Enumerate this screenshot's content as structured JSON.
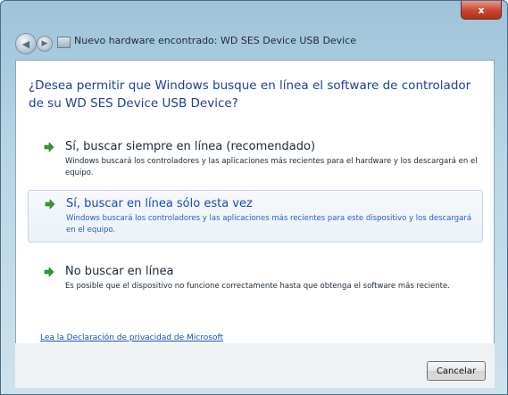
{
  "window": {
    "title": "Nuevo hardware encontrado: WD SES Device USB Device",
    "close_label": "x"
  },
  "question": "¿Desea permitir que Windows busque en línea el software de controlador de su WD SES Device USB Device?",
  "options": [
    {
      "title": "Sí, buscar siempre en línea (recomendado)",
      "description": "Windows buscará los controladores y las aplicaciones más recientes para el hardware y los descargará en el equipo."
    },
    {
      "title": "Sí, buscar en línea sólo esta vez",
      "description": "Windows buscará los controladores y las aplicaciones más recientes para este dispositivo y los descargará en el equipo."
    },
    {
      "title": "No buscar en línea",
      "description": "Es posible que el dispositivo no funcione correctamente hasta que obtenga el software más reciente."
    }
  ],
  "privacy_link": "Lea la Declaración de privacidad de Microsoft",
  "cancel_label": "Cancelar",
  "colors": {
    "accent_blue": "#1f3f9a",
    "link_blue": "#1a4bbd",
    "arrow_green": "#2f9a3a",
    "close_red": "#c9442d"
  },
  "icons": {
    "back": "back-arrow-icon",
    "forward": "forward-arrow-icon",
    "device": "hardware-device-icon",
    "option_arrow": "green-arrow-icon"
  }
}
